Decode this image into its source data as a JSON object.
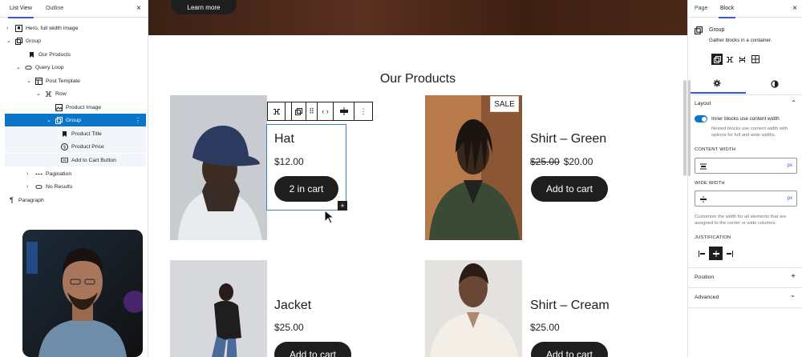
{
  "left_panel": {
    "tabs": [
      "List View",
      "Outline"
    ],
    "close": "×",
    "tree": [
      {
        "label": "Hero, full width image",
        "chev": "›",
        "icon": "bookmark-square-icon"
      },
      {
        "label": "Group",
        "chev": "⌄",
        "icon": "group-icon"
      },
      {
        "label": "Our Products",
        "chev": "",
        "icon": "bookmark-icon"
      },
      {
        "label": "Query Loop",
        "chev": "⌄",
        "icon": "loop-icon"
      },
      {
        "label": "Post Template",
        "chev": "⌄",
        "icon": "layout-icon"
      },
      {
        "label": "Row",
        "chev": "⌄",
        "icon": "row-icon"
      },
      {
        "label": "Product Image",
        "chev": "",
        "icon": "image-icon"
      },
      {
        "label": "Group",
        "chev": "⌄",
        "icon": "group-icon"
      },
      {
        "label": "Product Title",
        "chev": "",
        "icon": "bookmark-icon"
      },
      {
        "label": "Product Price",
        "chev": "",
        "icon": "price-icon"
      },
      {
        "label": "Add to Cart Button",
        "chev": "",
        "icon": "button-icon"
      },
      {
        "label": "Pagination",
        "chev": "›",
        "icon": "pagination-icon"
      },
      {
        "label": "No Results",
        "chev": "›",
        "icon": "loop-icon"
      },
      {
        "label": "Paragraph",
        "chev": "",
        "icon": "paragraph-icon"
      }
    ],
    "row_options": "⋮"
  },
  "canvas": {
    "hero_button": "Learn more",
    "section_title": "Our Products",
    "sale_badge": "SALE",
    "products": [
      {
        "title": "Hat",
        "price": "$12.00",
        "old_price": "",
        "button": "2 in cart"
      },
      {
        "title": "Shirt – Green",
        "price": "$20.00",
        "old_price": "$25.00",
        "button": "Add to cart"
      },
      {
        "title": "Jacket",
        "price": "$25.00",
        "old_price": "",
        "button": "Add to cart"
      },
      {
        "title": "Shirt – Cream",
        "price": "$25.00",
        "old_price": "",
        "button": "Add to cart"
      }
    ],
    "toolbar_icons": [
      "row-icon",
      "group-icon",
      "drag-handle-icon",
      "code-arrows-icon",
      "justify-center-icon",
      "more-vertical-icon"
    ],
    "inserter": "+"
  },
  "right_panel": {
    "tabs": [
      "Page",
      "Block"
    ],
    "close": "×",
    "block_name": "Group",
    "block_desc": "Gather blocks in a container.",
    "layout_title": "Layout",
    "toggle_label": "Inner blocks use content width",
    "toggle_on": true,
    "toggle_help": "Nested blocks use content width with options for full and wide widths.",
    "content_width_label": "CONTENT WIDTH",
    "wide_width_label": "WIDE WIDTH",
    "unit": "px",
    "width_help": "Customize the width for all elements that are assigned to the center or wide columns.",
    "justification_label": "JUSTIFICATION",
    "position_label": "Position",
    "advanced_label": "Advanced",
    "plus": "+",
    "accent": "#3858e9",
    "selected_row_color": "#0b75c7"
  }
}
